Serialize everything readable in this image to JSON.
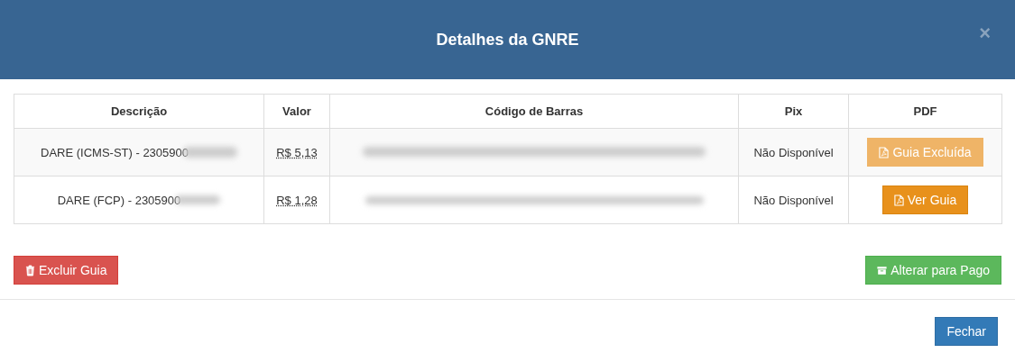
{
  "modal": {
    "title": "Detalhes da GNRE",
    "close": "×"
  },
  "table": {
    "columns": [
      "Descrição",
      "Valor",
      "Código de Barras",
      "Pix",
      "PDF"
    ],
    "rows": [
      {
        "description": "DARE (ICMS-ST) - 2305900",
        "value": "R$ 5,13",
        "pix": "Não Disponível",
        "pdf_button": {
          "label": "Guia Excluída",
          "disabled": true
        }
      },
      {
        "description": "DARE (FCP) - 2305900",
        "value": "R$ 1,28",
        "pix": "Não Disponível",
        "pdf_button": {
          "label": "Ver Guia",
          "disabled": false
        }
      }
    ]
  },
  "actions": {
    "delete": "Excluir Guia",
    "mark_paid": "Alterar para Pago"
  },
  "footer": {
    "close": "Fechar"
  }
}
